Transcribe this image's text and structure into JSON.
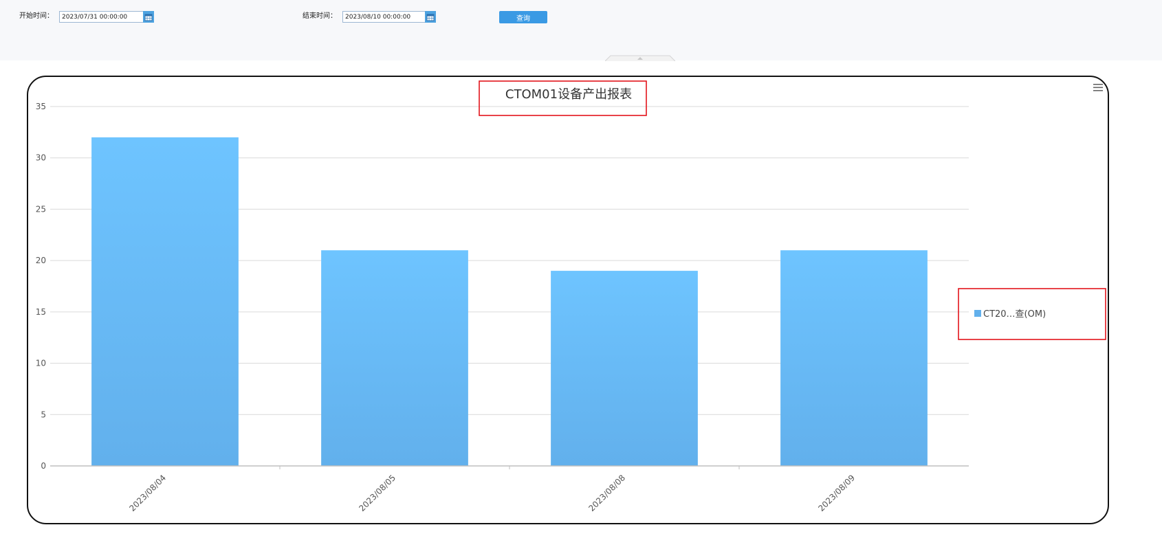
{
  "filters": {
    "start_label": "开始时间：",
    "start_value": "2023/07/31 00:00:00",
    "end_label": "结束时间：",
    "end_value": "2023/08/10 00:00:00",
    "query_label": "查询"
  },
  "colors": {
    "bar_top": "#6ec4ff",
    "bar_bottom": "#62b0ec",
    "accent": "#3a9ae4",
    "annotation": "#e3131b"
  },
  "icons": {
    "calendar": "calendar-icon",
    "menu": "hamburger-menu-icon",
    "collapse": "chevron-up-icon"
  },
  "chart_data": {
    "type": "bar",
    "title": "CTOM01设备产出报表",
    "categories": [
      "2023/08/04",
      "2023/08/05",
      "2023/08/08",
      "2023/08/09"
    ],
    "series": [
      {
        "name": "CT20…查(OM)",
        "values": [
          32,
          21,
          19,
          21
        ]
      }
    ],
    "ylim": [
      0,
      35
    ],
    "yticks": [
      0,
      5,
      10,
      15,
      20,
      25,
      30,
      35
    ],
    "grid": true,
    "legend_position": "right",
    "xlabel": "",
    "ylabel": ""
  }
}
